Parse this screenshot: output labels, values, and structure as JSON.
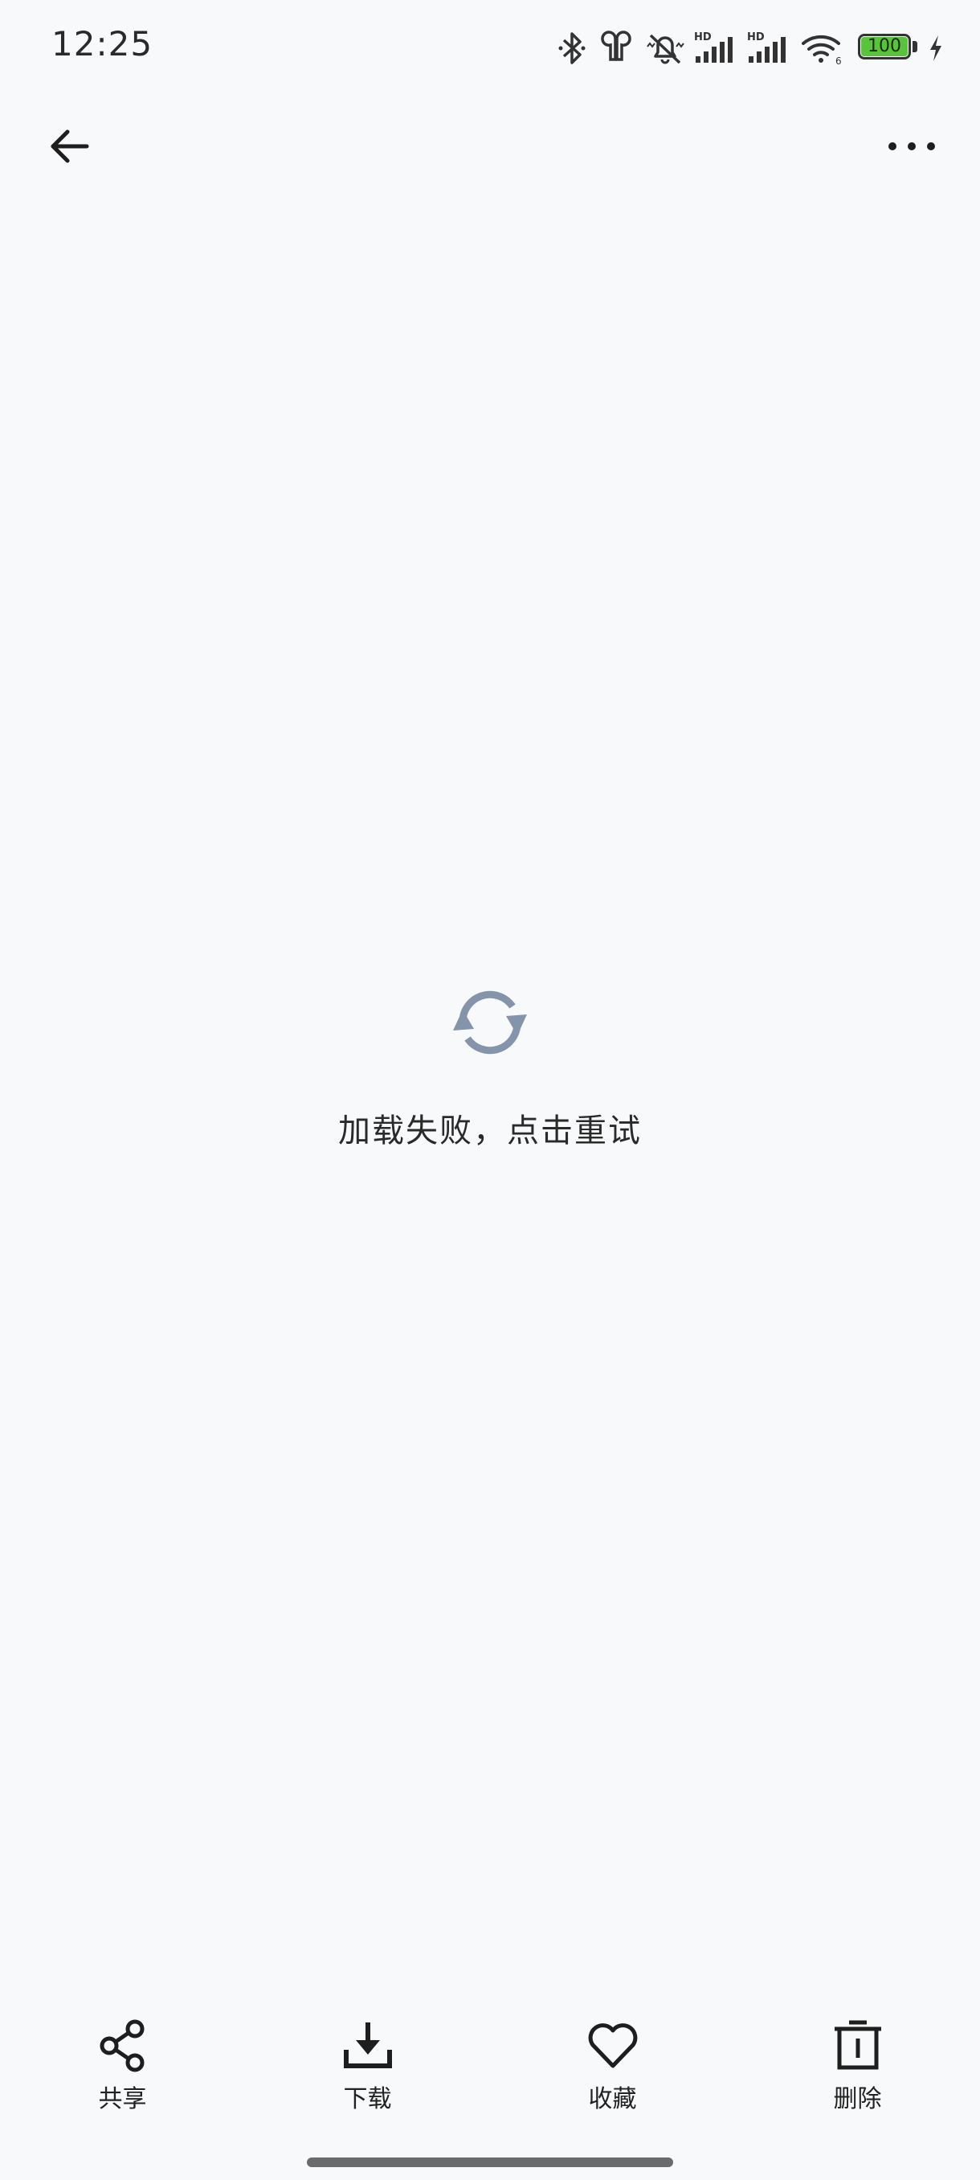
{
  "status_bar": {
    "time": "12:25",
    "battery_level": "100",
    "battery_color": "#58c33b",
    "icons": [
      "bluetooth-icon",
      "earbuds-icon",
      "mute-icon",
      "hd-signal-icon",
      "hd-signal-icon",
      "wifi-icon",
      "battery-icon",
      "charging-icon"
    ]
  },
  "app_bar": {
    "back_icon": "arrow-left-icon",
    "more_icon": "more-horizontal-icon"
  },
  "error_state": {
    "icon": "refresh-icon",
    "icon_color": "#8494aa",
    "message": "加载失败，点击重试"
  },
  "toolbar": {
    "items": [
      {
        "icon": "share-icon",
        "label": "共享"
      },
      {
        "icon": "download-icon",
        "label": "下载"
      },
      {
        "icon": "heart-icon",
        "label": "收藏"
      },
      {
        "icon": "trash-icon",
        "label": "删除"
      }
    ]
  }
}
